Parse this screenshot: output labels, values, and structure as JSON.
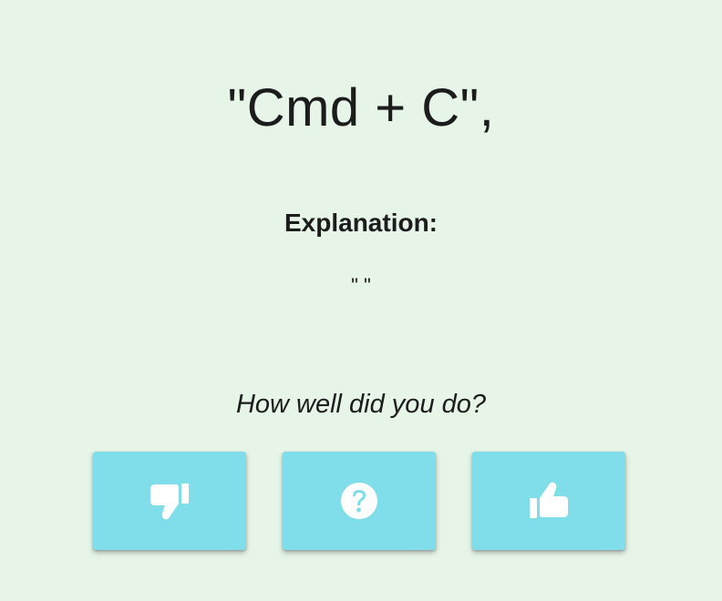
{
  "card": {
    "question": "\"Cmd + C\",",
    "explanation_label": "Explanation:",
    "explanation_text": "\" \"",
    "prompt": "How well did you do?"
  },
  "buttons": [
    {
      "icon": "thumbs-down-icon"
    },
    {
      "icon": "question-circle-icon"
    },
    {
      "icon": "thumbs-up-icon"
    }
  ],
  "colors": {
    "background": "#e7f5e9",
    "button": "#80deea",
    "icon": "#ffffff",
    "text": "#1c1c1c"
  }
}
